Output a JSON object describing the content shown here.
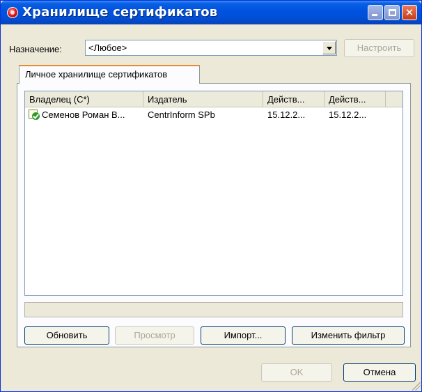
{
  "window": {
    "title": "Хранилище сертификатов",
    "controls": {
      "minimize": "minimize",
      "maximize": "maximize",
      "close": "close"
    }
  },
  "purpose": {
    "label": "Назначение:",
    "selected": "<Любое>",
    "configure_button": "Настроить"
  },
  "tabs": [
    {
      "label": "Личное хранилище сертификатов",
      "active": true
    }
  ],
  "certificates": {
    "columns": [
      "Владелец (С*)",
      "Издатель",
      "Действ...",
      "Действ..."
    ],
    "rows": [
      {
        "icon": "certificate-valid-icon",
        "owner": "Семенов Роман В...",
        "issuer": "CentrInform SPb",
        "valid_from": "15.12.2...",
        "valid_to": "15.12.2..."
      }
    ]
  },
  "actions": {
    "refresh": "Обновить",
    "view": "Просмотр",
    "import": "Импорт...",
    "change_filter": "Изменить фильтр"
  },
  "dialog": {
    "ok": "OK",
    "cancel": "Отмена"
  },
  "colors": {
    "titlebar": "#0053e1",
    "window_bg": "#ece9d8",
    "tab_accent": "#e68b2c",
    "button_border": "#003c74"
  }
}
